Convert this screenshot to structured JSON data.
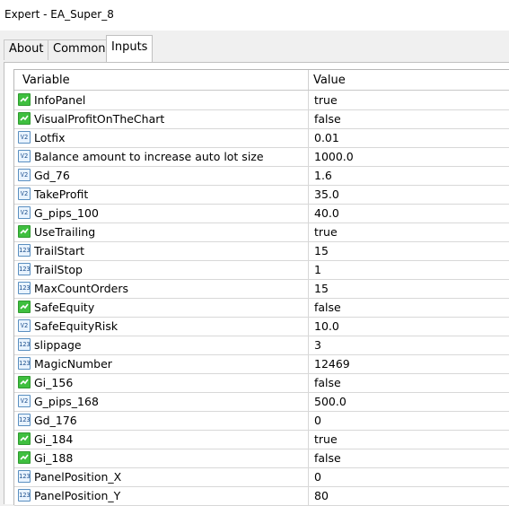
{
  "window": {
    "title": "Expert - EA_Super_8"
  },
  "tabs": [
    {
      "label": "About"
    },
    {
      "label": "Common"
    },
    {
      "label": "Inputs"
    }
  ],
  "table": {
    "headers": {
      "variable": "Variable",
      "value": "Value"
    },
    "type_icons": {
      "bool": "bool-check-icon",
      "double": "v2-type-icon",
      "int": "123-type-icon"
    },
    "type_icon_text": {
      "double": "V2",
      "int": "123"
    },
    "rows": [
      {
        "name": "InfoPanel",
        "value": "true",
        "type": "bool"
      },
      {
        "name": "VisualProfitOnTheChart",
        "value": "false",
        "type": "bool"
      },
      {
        "name": "Lotfix",
        "value": "0.01",
        "type": "double"
      },
      {
        "name": "Balance amount to increase auto lot size",
        "value": "1000.0",
        "type": "double"
      },
      {
        "name": "Gd_76",
        "value": "1.6",
        "type": "double"
      },
      {
        "name": "TakeProfit",
        "value": "35.0",
        "type": "double"
      },
      {
        "name": "G_pips_100",
        "value": "40.0",
        "type": "double"
      },
      {
        "name": "UseTrailing",
        "value": "true",
        "type": "bool"
      },
      {
        "name": "TrailStart",
        "value": "15",
        "type": "int"
      },
      {
        "name": "TrailStop",
        "value": "1",
        "type": "int"
      },
      {
        "name": "MaxCountOrders",
        "value": "15",
        "type": "int"
      },
      {
        "name": "SafeEquity",
        "value": "false",
        "type": "bool"
      },
      {
        "name": "SafeEquityRisk",
        "value": "10.0",
        "type": "double"
      },
      {
        "name": "slippage",
        "value": "3",
        "type": "int"
      },
      {
        "name": "MagicNumber",
        "value": "12469",
        "type": "int"
      },
      {
        "name": "Gi_156",
        "value": "false",
        "type": "bool"
      },
      {
        "name": "G_pips_168",
        "value": "500.0",
        "type": "double"
      },
      {
        "name": "Gd_176",
        "value": "0",
        "type": "int"
      },
      {
        "name": "Gi_184",
        "value": "true",
        "type": "bool"
      },
      {
        "name": "Gi_188",
        "value": "false",
        "type": "bool"
      },
      {
        "name": "PanelPosition_X",
        "value": "0",
        "type": "int"
      },
      {
        "name": "PanelPosition_Y",
        "value": "80",
        "type": "int"
      }
    ]
  }
}
